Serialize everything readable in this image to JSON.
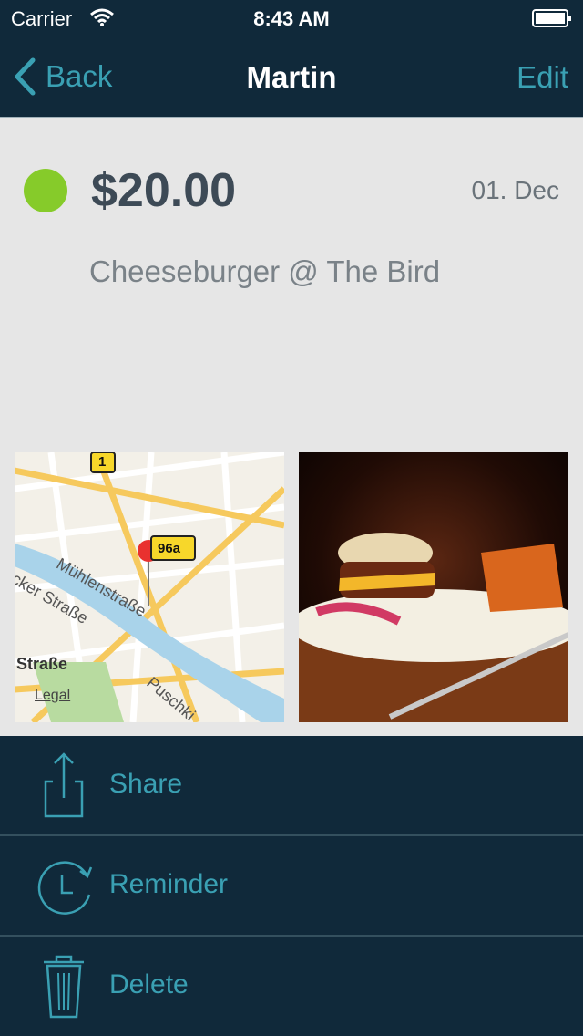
{
  "status": {
    "carrier": "Carrier",
    "time": "8:43 AM"
  },
  "nav": {
    "back_label": "Back",
    "title": "Martin",
    "edit_label": "Edit"
  },
  "entry": {
    "amount": "$20.00",
    "date": "01. Dec",
    "description": "Cheeseburger @ The Bird",
    "status_color": "#86cb2a"
  },
  "map": {
    "route_badge_1": "1",
    "route_badge_2": "96a",
    "street_1": "Mühlenstraße",
    "street_2": "cker Straße",
    "street_3": "Straße",
    "street_4": "Puschki",
    "legal": "Legal"
  },
  "actions": [
    {
      "label": "Share",
      "icon": "share-icon"
    },
    {
      "label": "Reminder",
      "icon": "reminder-clock-icon"
    },
    {
      "label": "Delete",
      "icon": "trash-icon"
    }
  ],
  "colors": {
    "nav_bg": "#10293a",
    "accent": "#3aa0b3",
    "content_bg": "#e6e6e6"
  }
}
